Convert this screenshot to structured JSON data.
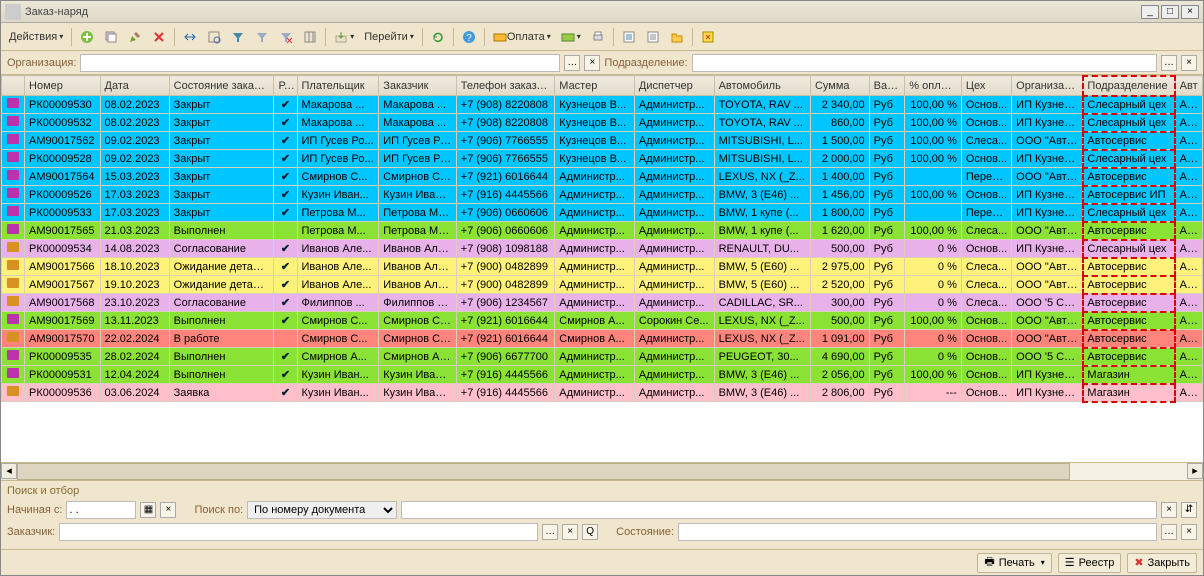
{
  "window": {
    "title": "Заказ-наряд"
  },
  "toolbar": {
    "actions": "Действия",
    "go": "Перейти",
    "pay": "Оплата"
  },
  "filter": {
    "org_label": "Организация:",
    "sub_label": "Подразделение:"
  },
  "grid": {
    "columns": [
      "",
      "Номер",
      "Дата",
      "Состояние заказ-...",
      "Р...",
      "Плательщик",
      "Заказчик",
      "Телефон заказч...",
      "Мастер",
      "Диспетчер",
      "Автомобиль",
      "Сумма",
      "Вал...",
      "% оплат...",
      "Цех",
      "Организац...",
      "Подразделение",
      "Авт"
    ],
    "widths": [
      22,
      72,
      66,
      100,
      22,
      78,
      74,
      94,
      76,
      76,
      92,
      56,
      34,
      54,
      48,
      68,
      88,
      26
    ],
    "rows": [
      {
        "bg": "cyan",
        "ic": "p",
        "num": "РК00009530",
        "date": "08.02.2023",
        "state": "Закрыт",
        "r": "✔",
        "payer": "Макарова ...",
        "cust": "Макарова ...",
        "phone": "+7 (908) 8220808",
        "master": "Кузнецов В...",
        "disp": "Администр...",
        "auto": "TOYOTA, RAV ...",
        "sum": "2 340,00",
        "cur": "Руб",
        "pct": "100,00 %",
        "shop": "Основ...",
        "org": "ИП Кузнец...",
        "sub": "Слесарный цех",
        "a": "Адм"
      },
      {
        "bg": "cyan",
        "ic": "p",
        "num": "РК00009532",
        "date": "08.02.2023",
        "state": "Закрыт",
        "r": "✔",
        "payer": "Макарова ...",
        "cust": "Макарова ...",
        "phone": "+7 (908) 8220808",
        "master": "Кузнецов В...",
        "disp": "Администр...",
        "auto": "TOYOTA, RAV ...",
        "sum": "860,00",
        "cur": "Руб",
        "pct": "100,00 %",
        "shop": "Основ...",
        "org": "ИП Кузнец...",
        "sub": "Слесарный цех",
        "a": "Адм"
      },
      {
        "bg": "cyan",
        "ic": "p",
        "num": "АМ90017562",
        "date": "09.02.2023",
        "state": "Закрыт",
        "r": "✔",
        "payer": "ИП Гусев Ро...",
        "cust": "ИП Гусев Ро...",
        "phone": "+7 (906) 7766555",
        "master": "Кузнецов В...",
        "disp": "Администр...",
        "auto": "MITSUBISHI, L...",
        "sum": "1 500,00",
        "cur": "Руб",
        "pct": "100,00 %",
        "shop": "Слеса...",
        "org": "ООО \"Авто...",
        "sub": "Автосервис",
        "a": "Адм"
      },
      {
        "bg": "cyan",
        "ic": "p",
        "num": "РК00009528",
        "date": "09.02.2023",
        "state": "Закрыт",
        "r": "✔",
        "payer": "ИП Гусев Ро...",
        "cust": "ИП Гусев Ро...",
        "phone": "+7 (906) 7766555",
        "master": "Кузнецов В...",
        "disp": "Администр...",
        "auto": "MITSUBISHI, L...",
        "sum": "2 000,00",
        "cur": "Руб",
        "pct": "100,00 %",
        "shop": "Основ...",
        "org": "ИП Кузнец...",
        "sub": "Слесарный цех",
        "a": "Адм"
      },
      {
        "bg": "cyan",
        "ic": "p",
        "num": "АМ90017564",
        "date": "15.03.2023",
        "state": "Закрыт",
        "r": "✔",
        "payer": "Смирнов С...",
        "cust": "Смирнов Се...",
        "phone": "+7 (921) 6016644",
        "master": "Администр...",
        "disp": "Администр...",
        "auto": "LEXUS, NX (_Z...",
        "sum": "1 400,00",
        "cur": "Руб",
        "pct": "",
        "shop": "Переп...",
        "org": "ООО \"Авто...",
        "sub": "Автосервис",
        "a": "Адм"
      },
      {
        "bg": "cyan",
        "ic": "p",
        "num": "РК00009526",
        "date": "17.03.2023",
        "state": "Закрыт",
        "r": "✔",
        "payer": "Кузин Иван...",
        "cust": "Кузин Иван ...",
        "phone": "+7 (916) 4445566",
        "master": "Администр...",
        "disp": "Администр...",
        "auto": "BMW, 3 (E46) ...",
        "sum": "1 456,00",
        "cur": "Руб",
        "pct": "100,00 %",
        "shop": "Основ...",
        "org": "ИП Кузнец...",
        "sub": "Автосервис ИП",
        "a": "Адм"
      },
      {
        "bg": "cyan",
        "ic": "p",
        "num": "РК00009533",
        "date": "17.03.2023",
        "state": "Закрыт",
        "r": "✔",
        "payer": "Петрова М...",
        "cust": "Петрова Ма...",
        "phone": "+7 (906) 0660606",
        "master": "Администр...",
        "disp": "Администр...",
        "auto": "BMW, 1 купе (...",
        "sum": "1 800,00",
        "cur": "Руб",
        "pct": "",
        "shop": "Переп...",
        "org": "ИП Кузнец...",
        "sub": "Слесарный цех",
        "a": "Адм"
      },
      {
        "bg": "green",
        "ic": "p",
        "num": "АМ90017565",
        "date": "21.03.2023",
        "state": "Выполнен",
        "r": "",
        "payer": "Петрова М...",
        "cust": "Петрова Ма...",
        "phone": "+7 (906) 0660606",
        "master": "Администр...",
        "disp": "Администр...",
        "auto": "BMW, 1 купе (...",
        "sum": "1 620,00",
        "cur": "Руб",
        "pct": "100,00 %",
        "shop": "Слеса...",
        "org": "ООО \"Авто...",
        "sub": "Автосервис",
        "a": "Адм"
      },
      {
        "bg": "violet",
        "ic": "y",
        "num": "РК00009534",
        "date": "14.08.2023",
        "state": "Согласование",
        "r": "✔",
        "payer": "Иванов Але...",
        "cust": "Иванов Алек...",
        "phone": "+7 (908) 1098188",
        "master": "Администр...",
        "disp": "Администр...",
        "auto": "RENAULT, DU...",
        "sum": "500,00",
        "cur": "Руб",
        "pct": "0 %",
        "shop": "Основ...",
        "org": "ИП Кузнец...",
        "sub": "Слесарный цех",
        "a": "Адм"
      },
      {
        "bg": "yellow",
        "ic": "y",
        "num": "АМ90017566",
        "date": "18.10.2023",
        "state": "Ожидание деталей",
        "r": "✔",
        "payer": "Иванов Але...",
        "cust": "Иванов Алек...",
        "phone": "+7 (900) 0482899",
        "master": "Администр...",
        "disp": "Администр...",
        "auto": "BMW, 5 (E60) ...",
        "sum": "2 975,00",
        "cur": "Руб",
        "pct": "0 %",
        "shop": "Слеса...",
        "org": "ООО \"Авто...",
        "sub": "Автосервис",
        "a": "Адм"
      },
      {
        "bg": "yellow",
        "ic": "y",
        "num": "АМ90017567",
        "date": "19.10.2023",
        "state": "Ожидание деталей",
        "r": "✔",
        "payer": "Иванов Але...",
        "cust": "Иванов Алек...",
        "phone": "+7 (900) 0482899",
        "master": "Администр...",
        "disp": "Администр...",
        "auto": "BMW, 5 (E60) ...",
        "sum": "2 520,00",
        "cur": "Руб",
        "pct": "0 %",
        "shop": "Слеса...",
        "org": "ООО \"Авто...",
        "sub": "Автосервис",
        "a": "Адм"
      },
      {
        "bg": "violet",
        "ic": "y",
        "num": "АМ90017568",
        "date": "23.10.2023",
        "state": "Согласование",
        "r": "✔",
        "payer": "Филиппов ...",
        "cust": "Филиппов В...",
        "phone": "+7 (906) 1234567",
        "master": "Администр...",
        "disp": "Администр...",
        "auto": "CADILLAC, SR...",
        "sum": "300,00",
        "cur": "Руб",
        "pct": "0 %",
        "shop": "Слеса...",
        "org": "ООО '5 СИ...",
        "sub": "Автосервис",
        "a": "Адм"
      },
      {
        "bg": "green",
        "ic": "p",
        "num": "АМ90017569",
        "date": "13.11.2023",
        "state": "Выполнен",
        "r": "✔",
        "payer": "Смирнов С...",
        "cust": "Смирнов Се...",
        "phone": "+7 (921) 6016644",
        "master": "Смирнов А...",
        "disp": "Сорокин Се...",
        "auto": "LEXUS, NX (_Z...",
        "sum": "500,00",
        "cur": "Руб",
        "pct": "100,00 %",
        "shop": "Основ...",
        "org": "ООО \"Авто...",
        "sub": "Автосервис",
        "a": "Адм"
      },
      {
        "bg": "red",
        "ic": "y",
        "num": "АМ90017570",
        "date": "22.02.2024",
        "state": "В работе",
        "r": "",
        "payer": "Смирнов С...",
        "cust": "Смирнов Се...",
        "phone": "+7 (921) 6016644",
        "master": "Смирнов А...",
        "disp": "Администр...",
        "auto": "LEXUS, NX (_Z...",
        "sum": "1 091,00",
        "cur": "Руб",
        "pct": "0 %",
        "shop": "Основ...",
        "org": "ООО \"Авто...",
        "sub": "Автосервис",
        "a": "Адм"
      },
      {
        "bg": "green",
        "ic": "p",
        "num": "РК00009535",
        "date": "28.02.2024",
        "state": "Выполнен",
        "r": "✔",
        "payer": "Смирнов А...",
        "cust": "Смирнов Ал...",
        "phone": "+7 (906) 6677700",
        "master": "Администр...",
        "disp": "Администр...",
        "auto": "PEUGEOT, 30...",
        "sum": "4 690,00",
        "cur": "Руб",
        "pct": "0 %",
        "shop": "Основ...",
        "org": "ООО '5 СИ...",
        "sub": "Автосервис",
        "a": "Адм"
      },
      {
        "bg": "green",
        "ic": "p",
        "num": "РК00009531",
        "date": "12.04.2024",
        "state": "Выполнен",
        "r": "✔",
        "payer": "Кузин Иван...",
        "cust": "Кузин Иван ...",
        "phone": "+7 (916) 4445566",
        "master": "Администр...",
        "disp": "Администр...",
        "auto": "BMW, 3 (E46) ...",
        "sum": "2 056,00",
        "cur": "Руб",
        "pct": "100,00 %",
        "shop": "Основ...",
        "org": "ИП Кузнец...",
        "sub": "Магазин",
        "a": "Адм"
      },
      {
        "bg": "pink",
        "ic": "y",
        "num": "РК00009536",
        "date": "03.06.2024",
        "state": "Заявка",
        "r": "✔",
        "payer": "Кузин Иван...",
        "cust": "Кузин Иван ...",
        "phone": "+7 (916) 4445566",
        "master": "Администр...",
        "disp": "Администр...",
        "auto": "BMW, 3 (E46) ...",
        "sum": "2 806,00",
        "cur": "Руб",
        "pct": "---",
        "shop": "Основ...",
        "org": "ИП Кузнец...",
        "sub": "Магазин",
        "a": "Адм"
      }
    ]
  },
  "search": {
    "panel_title": "Поиск и отбор",
    "start": "Начиная с:",
    "start_value": ". .",
    "by": "Поиск по:",
    "by_value": "По номеру документа",
    "cust": "Заказчик:",
    "state": "Состояние:"
  },
  "footer": {
    "print": "Печать",
    "registry": "Реестр",
    "close": "Закрыть"
  }
}
